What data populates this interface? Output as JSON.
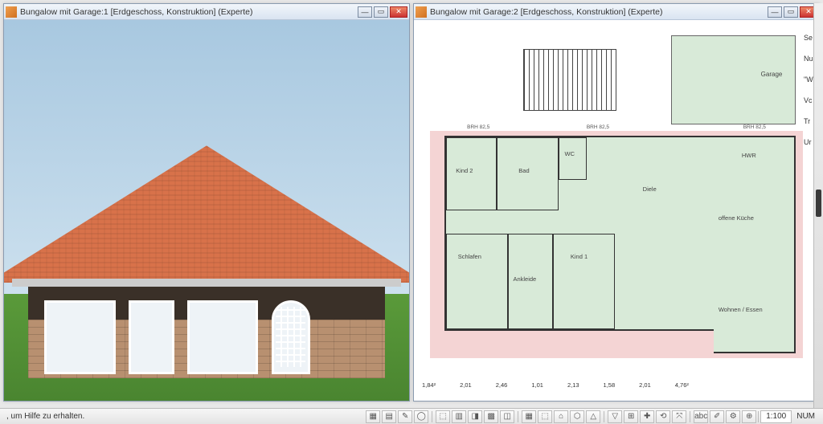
{
  "windows": {
    "left": {
      "title": "Bungalow mit Garage:1 [Erdgeschoss, Konstruktion] (Experte)"
    },
    "right": {
      "title": "Bungalow mit Garage:2 [Erdgeschoss, Konstruktion] (Experte)"
    }
  },
  "plan": {
    "garage": "Garage",
    "rooms": {
      "kind2": "Kind 2",
      "bad": "Bad",
      "wc": "WC",
      "hwr": "HWR",
      "diele": "Diele",
      "schlafen": "Schlafen",
      "ankleide": "Ankleide",
      "kind1": "Kind 1",
      "kueche": "offene Küche",
      "wohnen": "Wohnen / Essen"
    },
    "brh": "BRH 82,5",
    "dims": [
      "1,84²",
      "2,01",
      "2,46",
      "1,01",
      "2,13",
      "1,58",
      "2,01",
      "4,76²"
    ]
  },
  "status": {
    "hint": ", um Hilfe zu erhalten.",
    "scale": "1:100",
    "num": "NUM"
  },
  "side": {
    "se": "Se",
    "nu": "Nu",
    "w": "\"W",
    "vc": "Vc",
    "tr": "Tr",
    "ur": "Ur"
  },
  "icons": {
    "min": "—",
    "max": "▭",
    "close": "✕",
    "tools": [
      "▦",
      "▤",
      "✎",
      "◯",
      "⬚",
      "▥",
      "◨",
      "▩",
      "◫",
      "▦",
      "⬚",
      "⌂",
      "⬡",
      "△",
      "▽",
      "⊞",
      "✚",
      "⟲",
      "⤧",
      "abc",
      "✐",
      "⚙",
      "⊕"
    ]
  }
}
